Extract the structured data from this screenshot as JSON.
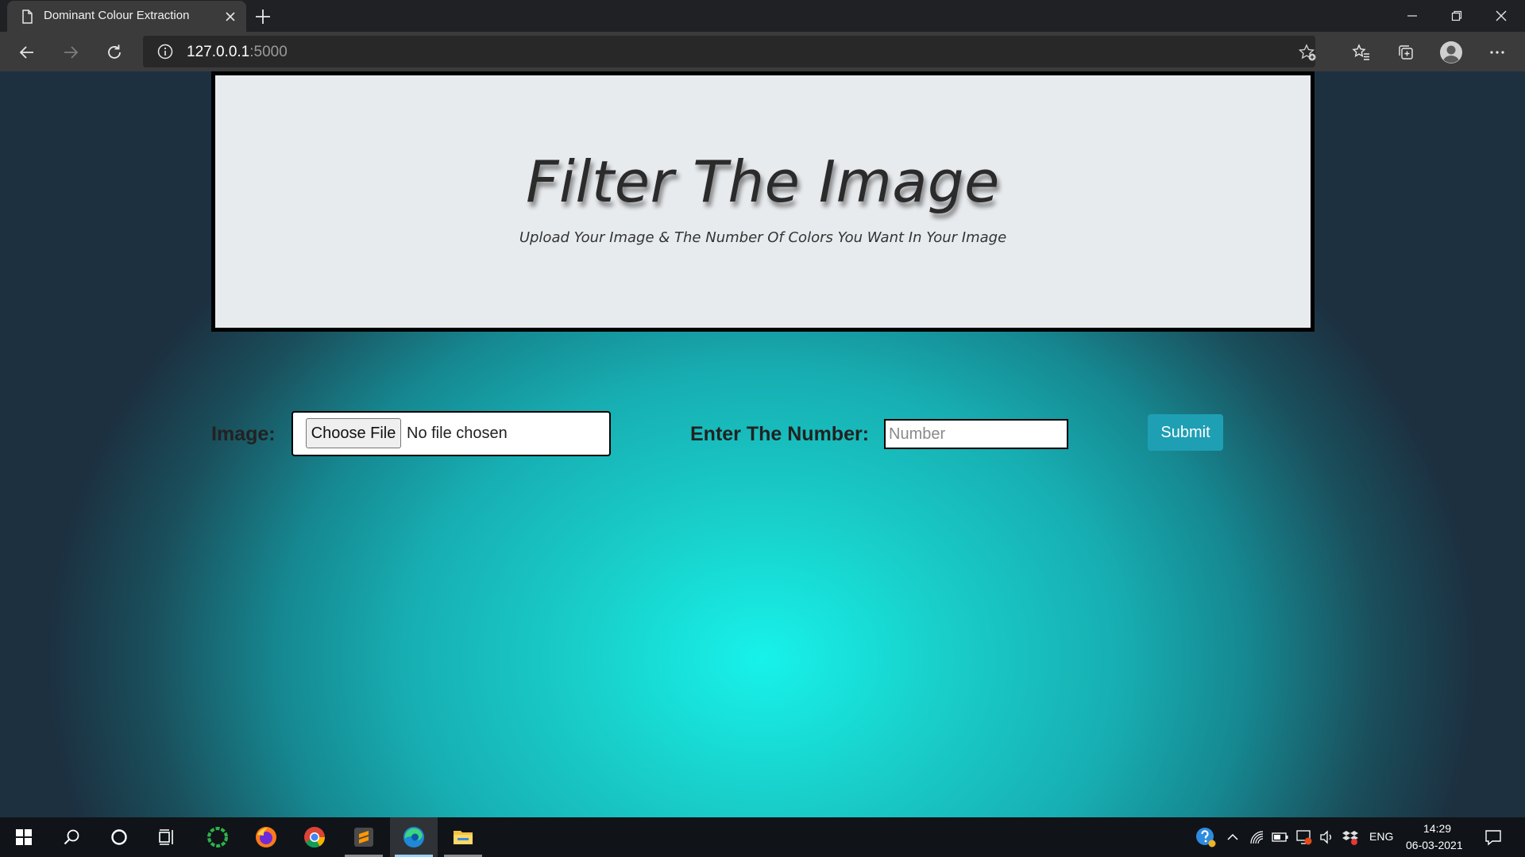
{
  "browser": {
    "tab_title": "Dominant Colour Extraction",
    "url_host": "127.0.0.1",
    "url_port": ":5000"
  },
  "page": {
    "title": "Filter The Image",
    "subtitle": "Upload Your Image & The Number Of Colors You Want In Your Image",
    "form": {
      "image_label": "Image:",
      "choose_file_label": "Choose File",
      "file_status": "No file chosen",
      "number_label": "Enter The Number:",
      "number_placeholder": "Number",
      "number_value": "",
      "submit_label": "Submit"
    }
  },
  "taskbar": {
    "apps": [
      "windows-start",
      "search",
      "cortana",
      "task-view",
      "app-green-ring",
      "firefox",
      "chrome",
      "sublime-text",
      "edge",
      "file-explorer"
    ],
    "language": "ENG",
    "time": "14:29",
    "date": "06-03-2021"
  },
  "colors": {
    "accent_button": "#1f9fb4",
    "page_center": "#17f2ea",
    "page_edge": "#1c3040"
  }
}
